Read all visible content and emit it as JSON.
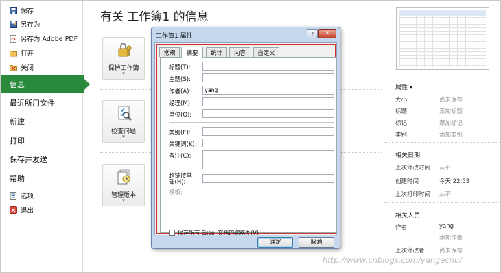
{
  "nav": {
    "items_small_top": [
      {
        "label": "保存",
        "icon": "save-icon"
      },
      {
        "label": "另存为",
        "icon": "save-as-icon"
      },
      {
        "label": "另存为 Adobe PDF",
        "icon": "pdf-icon"
      },
      {
        "label": "打开",
        "icon": "open-folder-icon"
      },
      {
        "label": "关闭",
        "icon": "close-folder-icon"
      }
    ],
    "items_big": [
      {
        "label": "信息",
        "active": true
      },
      {
        "label": "最近所用文件"
      },
      {
        "label": "新建"
      },
      {
        "label": "打印"
      },
      {
        "label": "保存并发送"
      },
      {
        "label": "帮助"
      }
    ],
    "items_small_bottom": [
      {
        "label": "选项",
        "icon": "options-icon"
      },
      {
        "label": "退出",
        "icon": "exit-icon"
      }
    ]
  },
  "main": {
    "title": "有关 工作簿1 的信息",
    "actions": [
      {
        "label": "保护工作簿",
        "icon": "lock-key-icon",
        "arrow": "▾"
      },
      {
        "label": "检查问题",
        "icon": "checklist-icon",
        "arrow": "▾"
      },
      {
        "label": "管理版本",
        "icon": "versions-icon",
        "arrow": "▾"
      }
    ]
  },
  "right_panel": {
    "properties_header": "属性 ▾",
    "properties": [
      {
        "key": "大小",
        "value": "尚未保存"
      },
      {
        "key": "标题",
        "value": "添加标题"
      },
      {
        "key": "标记",
        "value": "添加标记"
      },
      {
        "key": "类别",
        "value": "添加类别"
      }
    ],
    "dates_header": "相关日期",
    "dates": [
      {
        "key": "上次修改时间",
        "value": "从不"
      },
      {
        "key": "创建时间",
        "value": "今天 22:53"
      },
      {
        "key": "上次打印时间",
        "value": "从不"
      }
    ],
    "people_header": "相关人员",
    "author_key": "作者",
    "author_value": "yang",
    "add_author": "添加作者",
    "last_modified_by_key": "上次修改者",
    "last_modified_by_value": "尚未保存"
  },
  "dialog": {
    "title": "工作簿1 属性",
    "help": "?",
    "close": "✕",
    "tabs": [
      "常规",
      "摘要",
      "统计",
      "内容",
      "自定义"
    ],
    "active_tab": 1,
    "fields": [
      {
        "label": "标题(T):",
        "value": ""
      },
      {
        "label": "主题(S):",
        "value": ""
      },
      {
        "label": "作者(A):",
        "value": "yang"
      },
      {
        "label": "经理(M):",
        "value": ""
      },
      {
        "label": "单位(O):",
        "value": ""
      },
      {
        "label": "类别(E):",
        "value": ""
      },
      {
        "label": "关键词(K):",
        "value": ""
      },
      {
        "label": "备注(C):",
        "value": ""
      },
      {
        "label": "超链接基础(H):",
        "value": ""
      }
    ],
    "template_label": "模板:",
    "checkbox_label": "保存所有 Excel 文档的缩略图(V)",
    "ok": "确定",
    "cancel": "取消"
  },
  "watermark": "http://www.cnblogs.com/yangecnu/"
}
